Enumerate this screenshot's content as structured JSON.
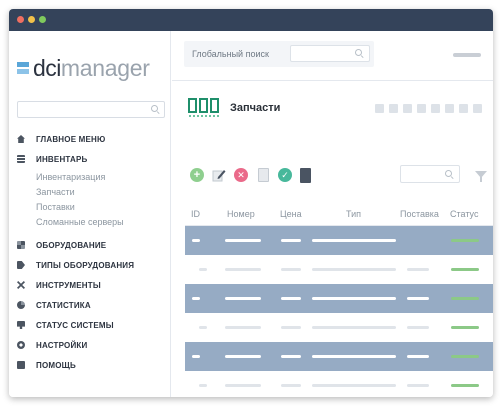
{
  "app": {
    "name_part1": "dci",
    "name_part2": "manager"
  },
  "topbar": {
    "global_search_label": "Глобальный поиск",
    "global_search_placeholder": ""
  },
  "sidebar": {
    "search_placeholder": "",
    "items": [
      {
        "id": "home",
        "label": "ГЛАВНОЕ МЕНЮ",
        "icon": "home-icon"
      },
      {
        "id": "inventory",
        "label": "ИНВЕНТАРЬ",
        "icon": "list-icon",
        "children": [
          "Инвентаризация",
          "Запчасти",
          "Поставки",
          "Сломанные серверы"
        ]
      },
      {
        "id": "equipment",
        "label": "ОБОРУДОВАНИЕ",
        "icon": "grid-icon"
      },
      {
        "id": "equipment-types",
        "label": "ТИПЫ ОБОРУДОВАНИЯ",
        "icon": "tag-icon"
      },
      {
        "id": "tools",
        "label": "ИНСТРУМЕНТЫ",
        "icon": "tools-icon"
      },
      {
        "id": "stats",
        "label": "СТАТИСТИКА",
        "icon": "pie-chart-icon"
      },
      {
        "id": "system-status",
        "label": "СТАТУС СИСТЕМЫ",
        "icon": "monitor-icon"
      },
      {
        "id": "settings",
        "label": "НАСТРОЙКИ",
        "icon": "gear-icon"
      },
      {
        "id": "help",
        "label": "ПОМОЩЬ",
        "icon": "help-icon"
      }
    ]
  },
  "page": {
    "title": "Запчасти",
    "icon": "spare-parts-icon"
  },
  "toolbar": {
    "buttons": [
      {
        "name": "add-button",
        "icon": "plus-icon",
        "glyph": "+"
      },
      {
        "name": "edit-button",
        "icon": "pencil-icon",
        "glyph": ""
      },
      {
        "name": "delete-button",
        "icon": "x-icon",
        "glyph": "✕"
      },
      {
        "name": "document-button",
        "icon": "document-icon",
        "glyph": ""
      },
      {
        "name": "confirm-button",
        "icon": "check-icon",
        "glyph": "✓"
      },
      {
        "name": "catalog-button",
        "icon": "book-icon",
        "glyph": ""
      }
    ],
    "filter_placeholder": ""
  },
  "table": {
    "columns": [
      "ID",
      "Номер",
      "Цена",
      "Тип",
      "Поставка",
      "Статус"
    ],
    "row_count": 6
  },
  "colors": {
    "titlebar": "#34435a",
    "row_highlight": "#96abc4",
    "status_ok": "#8cc987",
    "accent_green": "#1f8f6b"
  }
}
